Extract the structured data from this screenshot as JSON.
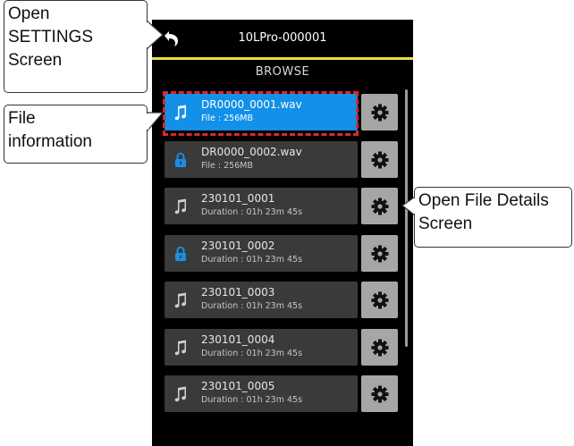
{
  "header": {
    "title": "10LPro-000001",
    "back_icon": "back-arrow-icon"
  },
  "section_title": "BROWSE",
  "colors": {
    "accent_line": "#e7df3f",
    "selected_row": "#1390e8",
    "row_bg": "#3a3a3a",
    "gear_bg": "#a6a6a6",
    "lock_icon": "#1a8ee6",
    "highlight_frame": "#e0262b"
  },
  "files": [
    {
      "name": "DR0000_0001.wav",
      "info": "File : 256MB",
      "icon": "music-note-icon",
      "selected": true
    },
    {
      "name": "DR0000_0002.wav",
      "info": "File : 256MB",
      "icon": "lock-icon",
      "selected": false
    },
    {
      "name": "230101_0001",
      "info": "Duration : 01h 23m 45s",
      "icon": "music-note-icon",
      "selected": false
    },
    {
      "name": "230101_0002",
      "info": "Duration : 01h 23m 45s",
      "icon": "lock-icon",
      "selected": false
    },
    {
      "name": "230101_0003",
      "info": "Duration : 01h 23m 45s",
      "icon": "music-note-icon",
      "selected": false
    },
    {
      "name": "230101_0004",
      "info": "Duration : 01h 23m 45s",
      "icon": "music-note-icon",
      "selected": false
    },
    {
      "name": "230101_0005",
      "info": "Duration : 01h 23m 45s",
      "icon": "music-note-icon",
      "selected": false
    }
  ],
  "callouts": {
    "settings": [
      "Open",
      "SETTINGS",
      "Screen"
    ],
    "file_info": [
      "File",
      "information"
    ],
    "file_details": [
      "Open File Details",
      "Screen"
    ]
  }
}
